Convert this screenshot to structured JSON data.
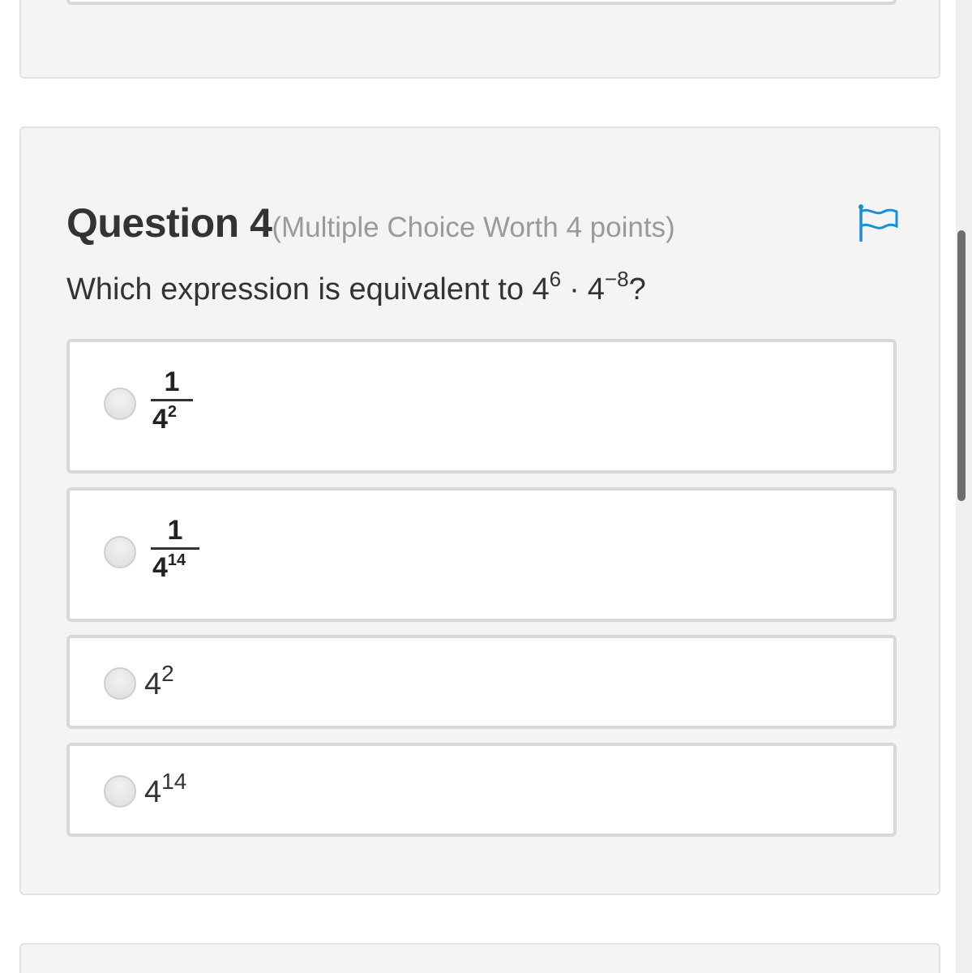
{
  "question": {
    "title": "Question 4",
    "meta": "(Multiple Choice Worth 4 points)",
    "text_prefix": "Which expression is equivalent to ",
    "base_1": "4",
    "exp_1": "6",
    "dot": "·",
    "base_2": "4",
    "exp_2": "−8",
    "text_suffix": "?"
  },
  "flag_icon": "flag-outline-icon",
  "accent_color": "#1a8fd1",
  "options": [
    {
      "type": "fraction",
      "numerator": "1",
      "den_base": "4",
      "den_exp": "2"
    },
    {
      "type": "fraction",
      "numerator": "1",
      "den_base": "4",
      "den_exp": "14"
    },
    {
      "type": "power",
      "base": "4",
      "exp": "2"
    },
    {
      "type": "power",
      "base": "4",
      "exp": "14"
    }
  ]
}
